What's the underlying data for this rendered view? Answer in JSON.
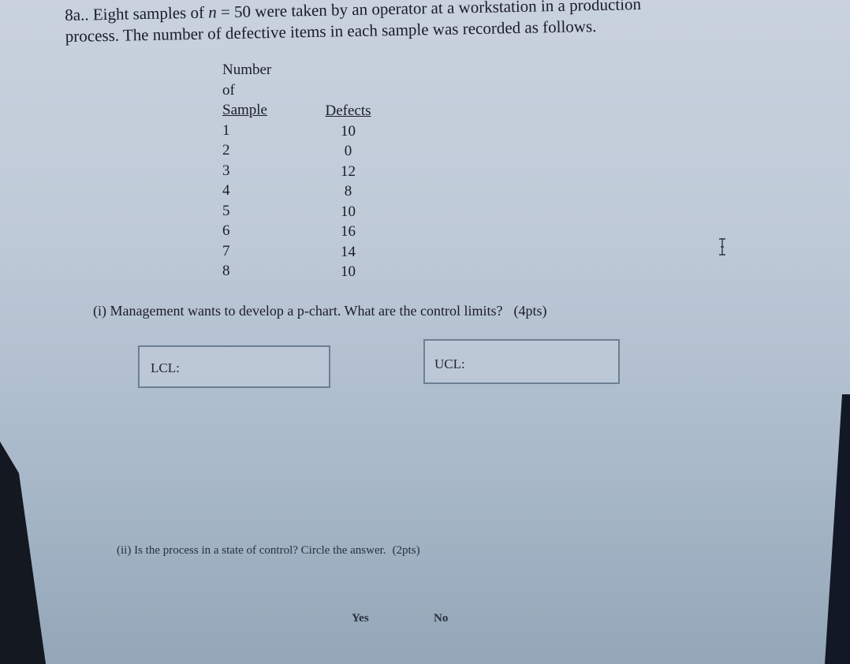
{
  "question": {
    "number": "8a..",
    "intro_line1_pre": "Eight samples of ",
    "var_n": "n",
    "intro_line1_post": " = 50 were taken by an operator at a workstation in a production",
    "intro_line2": "process.  The number of defective items in each sample was recorded as follows."
  },
  "table": {
    "sample_header_line1": "Number",
    "sample_header_line2": "of",
    "sample_header_line3": "Sample",
    "defects_header": "Defects",
    "rows": [
      {
        "sample": "1",
        "defects": "10"
      },
      {
        "sample": "2",
        "defects": "0"
      },
      {
        "sample": "3",
        "defects": "12"
      },
      {
        "sample": "4",
        "defects": "8"
      },
      {
        "sample": "5",
        "defects": "10"
      },
      {
        "sample": "6",
        "defects": "16"
      },
      {
        "sample": "7",
        "defects": "14"
      },
      {
        "sample": "8",
        "defects": "10"
      }
    ]
  },
  "part_i": {
    "text": "(i) Management wants to develop a p-chart.  What are the control limits?",
    "points": "(4pts)",
    "lcl_label": "LCL:",
    "ucl_label": "UCL:",
    "lcl_value": "",
    "ucl_value": ""
  },
  "part_ii": {
    "text": "(ii) Is the process in a state of control?  Circle the answer.",
    "points": "(2pts)",
    "options": [
      "Yes",
      "No"
    ]
  },
  "cursor": "text-cursor-icon"
}
